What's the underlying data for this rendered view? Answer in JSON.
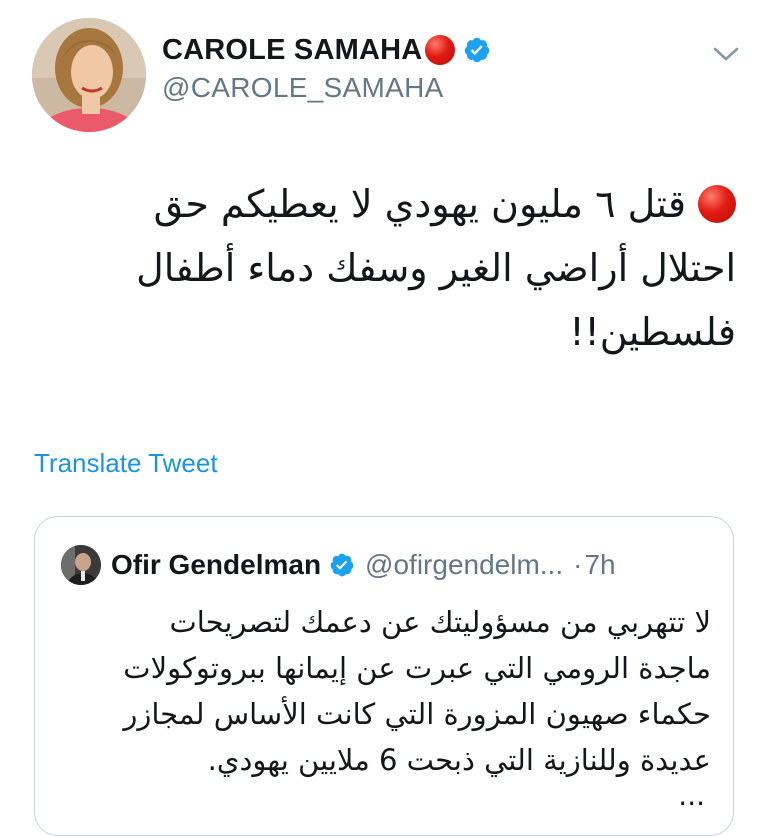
{
  "tweet": {
    "author": {
      "display_name": "CAROLE SAMAHA",
      "handle": "@CAROLE_SAMAHA",
      "verified": true,
      "avatar_icon": "profile-photo"
    },
    "text_lines": [
      "قتل ٦ مليون يهودي لا يعطيكم حق",
      "احتلال أراضي الغير  وسفك دماء أطفال",
      "فلسطين!!"
    ],
    "translate_label": "Translate Tweet",
    "menu_icon": "chevron-down-icon"
  },
  "quoted_tweet": {
    "author": {
      "display_name": "Ofir Gendelman",
      "handle": "@ofirgendelm...",
      "verified": true
    },
    "separator": "·",
    "time": "7h",
    "text_lines": [
      "لا تتهربي من مسؤوليتك عن دعمك لتصريحات",
      "ماجدة الرومي التي عبرت عن إيمانها ببروتوكولات",
      "حكماء صهيون المزورة التي كانت الأساس لمجازر",
      "عديدة وللنازية التي ذبحت 6 ملايين يهودي."
    ],
    "ellipsis": "..."
  },
  "colors": {
    "link_blue": "#1b95e0",
    "verified_blue": "#1da1f2",
    "secondary_text": "#657786",
    "red_circle": "#e01b12",
    "border": "#ccd6dd"
  }
}
